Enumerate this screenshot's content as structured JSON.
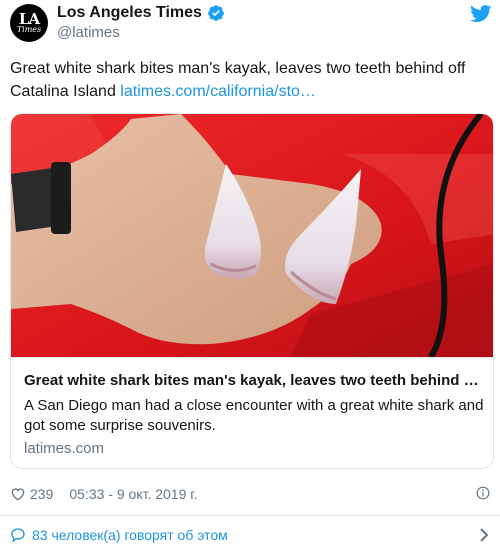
{
  "author": {
    "name": "Los Angeles Times",
    "handle": "@latimes",
    "avatar_line1": "LA",
    "avatar_line2": "Times",
    "verified": true
  },
  "tweet": {
    "text": "Great white shark bites man's kayak, leaves two teeth behind off Catalina Island",
    "link_text": "latimes.com/california/sto…"
  },
  "card": {
    "image_icon": "photo-hand-holding-shark-teeth",
    "title": "Great white shark bites man's kayak, leaves two teeth behind …",
    "description": "A San Diego man had a close encounter with a great white shark and got some surprise souvenirs.",
    "domain": "latimes.com"
  },
  "meta": {
    "likes": "239",
    "timestamp": "05:33 - 9 окт. 2019 г."
  },
  "footer": {
    "talking": "83 человек(а) говорят об этом"
  },
  "colors": {
    "link": "#1b95e0",
    "secondary_text": "#657786",
    "border": "#e1e8ed"
  }
}
